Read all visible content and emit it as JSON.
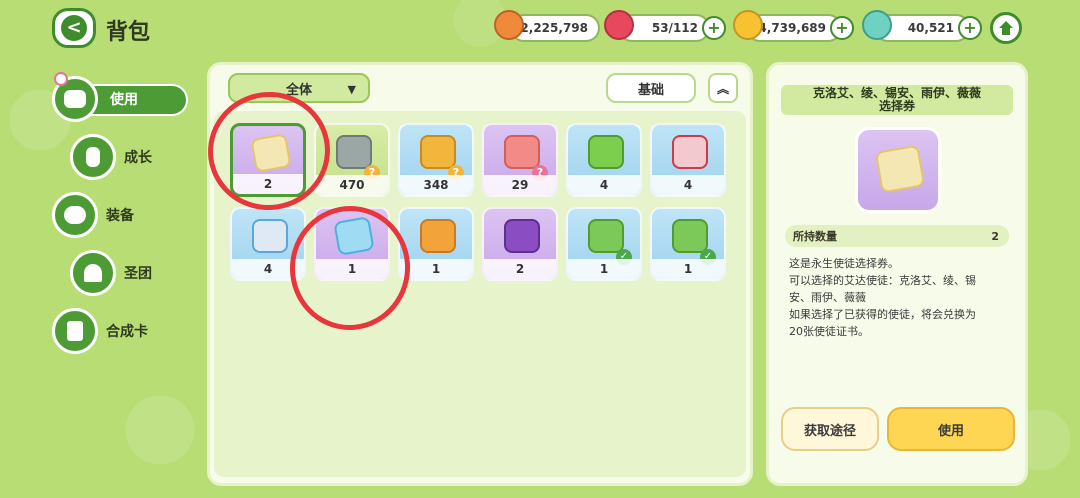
{
  "header": {
    "title": "背包",
    "back_label": "<"
  },
  "resources": [
    {
      "name": "cookie-coin",
      "value": "2,225,798"
    },
    {
      "name": "heart-gem",
      "value": "53/112"
    },
    {
      "name": "gold-coin",
      "value": "4,739,689"
    },
    {
      "name": "leaf-gem",
      "value": "40,521"
    }
  ],
  "nav": [
    {
      "label": "使用",
      "icon": "chest-icon"
    },
    {
      "label": "成长",
      "icon": "potion-icon"
    },
    {
      "label": "装备",
      "icon": "cloud-icon"
    },
    {
      "label": "圣团",
      "icon": "castle-icon"
    },
    {
      "label": "合成卡",
      "icon": "card-icon"
    }
  ],
  "toolbar": {
    "filter": "全体",
    "sort": "基础"
  },
  "items": [
    {
      "count": "2",
      "color": "purple"
    },
    {
      "count": "470",
      "color": "green"
    },
    {
      "count": "348",
      "color": "blue"
    },
    {
      "count": "29",
      "color": "purple"
    },
    {
      "count": "4",
      "color": "blue"
    },
    {
      "count": "4",
      "color": "blue"
    },
    {
      "count": "4",
      "color": "blue"
    },
    {
      "count": "1",
      "color": "purple"
    },
    {
      "count": "1",
      "color": "blue"
    },
    {
      "count": "2",
      "color": "purple"
    },
    {
      "count": "1",
      "color": "blue"
    },
    {
      "count": "1",
      "color": "blue"
    }
  ],
  "detail": {
    "name": "克洛艾、绫、锡安、雨伊、薇薇\n选择券",
    "qty_label": "所持数量",
    "qty_value": "2",
    "desc": "这是永生使徒选择券。\n可以选择的艾达使徒：克洛艾、绫、锡\n安、雨伊、薇薇\n如果选择了已获得的使徒，将会兑换为\n20张使徒证书。",
    "source_button": "获取途径",
    "use_button": "使用"
  }
}
